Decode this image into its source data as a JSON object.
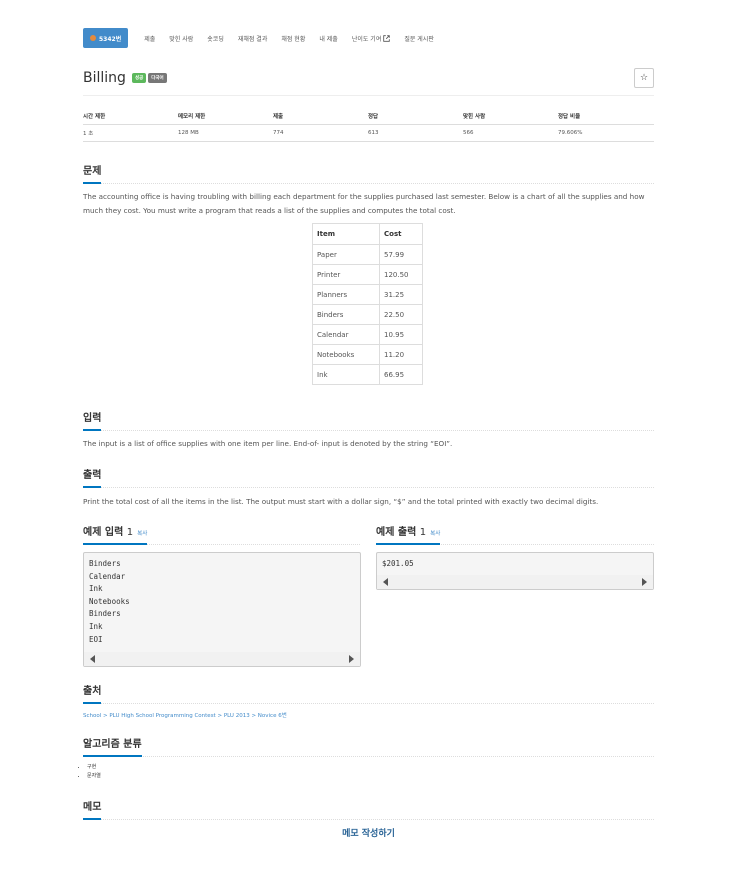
{
  "nav": {
    "problem_no": "5342번",
    "tabs": [
      "제출",
      "맞힌 사람",
      "숏코딩",
      "재채점 결과",
      "채점 현황",
      "내 제출",
      "난이도 기여",
      "질문 게시판"
    ]
  },
  "problem": {
    "title": "Billing",
    "badges": [
      "성공",
      "다국어"
    ],
    "star": "☆"
  },
  "info": {
    "headers": [
      "시간 제한",
      "메모리 제한",
      "제출",
      "정답",
      "맞힌 사람",
      "정답 비율"
    ],
    "values": [
      "1 초",
      "128 MB",
      "774",
      "613",
      "566",
      "79.606%"
    ]
  },
  "sections": {
    "problem": "문제",
    "input": "입력",
    "output": "출력",
    "sample_input": "예제 입력",
    "sample_output": "예제 출력",
    "sample_no": "1",
    "copy": "복사",
    "source": "출처",
    "algorithm": "알고리즘 분류",
    "memo": "메모"
  },
  "problem_text": "The accounting office is having troubling with billing each department for the supplies purchased last semester. Below is a chart of all the supplies and how much they cost. You must write a program that reads a list of the supplies and computes the total cost.",
  "cost_table": {
    "headers": [
      "Item",
      "Cost"
    ],
    "rows": [
      [
        "Paper",
        "57.99"
      ],
      [
        "Printer",
        "120.50"
      ],
      [
        "Planners",
        "31.25"
      ],
      [
        "Binders",
        "22.50"
      ],
      [
        "Calendar",
        "10.95"
      ],
      [
        "Notebooks",
        "11.20"
      ],
      [
        "Ink",
        "66.95"
      ]
    ]
  },
  "input_text": "The input is a list of office supplies with one item per line. End-of- input is denoted by the string “EOI”.",
  "output_text": "Print the total cost of all the items in the list. The output must start with a dollar sign, “$” and the total printed with exactly two decimal digits.",
  "sample_input_lines": [
    "Binders",
    "Calendar",
    "Ink",
    "Notebooks",
    "Binders",
    "Ink",
    "EOI"
  ],
  "sample_output_lines": [
    "$201.05"
  ],
  "source_text": "School > PLU High School Programming Contest > PLU 2013 > Novice 6번",
  "algorithm_tags": [
    "구현",
    "문자열"
  ],
  "memo_link": "메모 작성하기"
}
